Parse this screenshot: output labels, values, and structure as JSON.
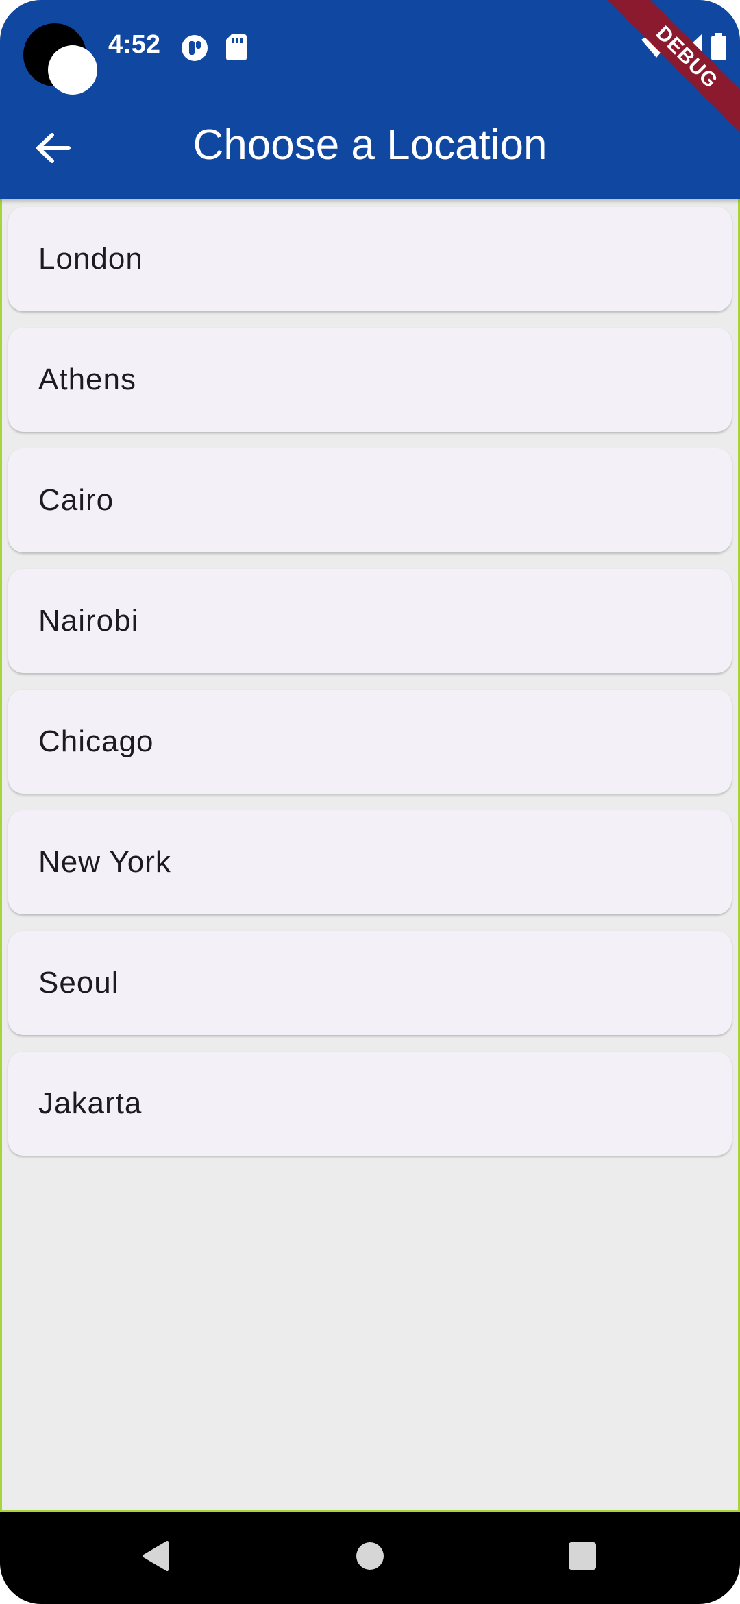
{
  "status_bar": {
    "time": "4:52"
  },
  "app_bar": {
    "title": "Choose a Location",
    "back_icon": "arrow-back-icon",
    "color": "#0f47a1"
  },
  "debug_banner": {
    "label": "DEBUG"
  },
  "locations": [
    {
      "label": "London"
    },
    {
      "label": "Athens"
    },
    {
      "label": "Cairo"
    },
    {
      "label": "Nairobi"
    },
    {
      "label": "Chicago"
    },
    {
      "label": "New York"
    },
    {
      "label": "Seoul"
    },
    {
      "label": "Jakarta"
    }
  ],
  "nav_bar": {
    "back_icon": "nav-back-icon",
    "home_icon": "nav-home-icon",
    "recents_icon": "nav-recents-icon"
  }
}
